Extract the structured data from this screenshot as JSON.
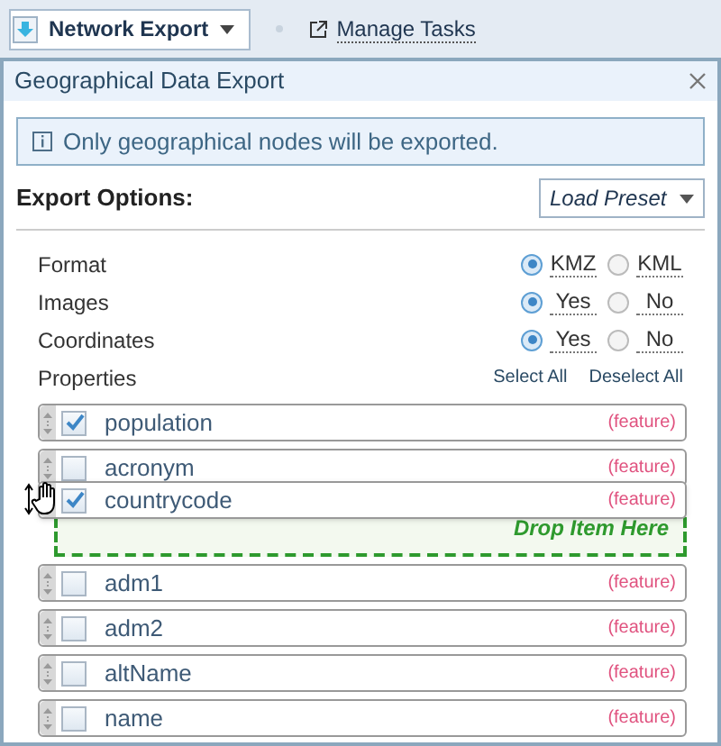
{
  "toolbar": {
    "menu_button": "Network Export",
    "link": "Manage Tasks"
  },
  "dialog": {
    "title": "Geographical Data Export",
    "info": "Only geographical nodes will be exported.",
    "section_title": "Export Options:",
    "preset_button": "Load Preset",
    "options": [
      {
        "label": "Format",
        "choices": [
          {
            "label": "KMZ",
            "selected": true
          },
          {
            "label": "KML",
            "selected": false
          }
        ]
      },
      {
        "label": "Images",
        "choices": [
          {
            "label": "Yes",
            "selected": true
          },
          {
            "label": "No",
            "selected": false
          }
        ]
      },
      {
        "label": "Coordinates",
        "choices": [
          {
            "label": "Yes",
            "selected": true
          },
          {
            "label": "No",
            "selected": false
          }
        ]
      }
    ],
    "properties": {
      "label": "Properties",
      "select_all": "Select All",
      "deselect_all": "Deselect All",
      "items": [
        {
          "kind": "property",
          "label": "population",
          "tag": "(feature)",
          "checked": true
        },
        {
          "kind": "property",
          "label": "acronym",
          "tag": "(feature)",
          "checked": false
        },
        {
          "kind": "drop-zone",
          "label": "Drop Item Here",
          "dragged": {
            "label": "countrycode",
            "tag": "(feature)",
            "checked": true
          }
        },
        {
          "kind": "property",
          "label": "adm1",
          "tag": "(feature)",
          "checked": false
        },
        {
          "kind": "property",
          "label": "adm2",
          "tag": "(feature)",
          "checked": false
        },
        {
          "kind": "property",
          "label": "altName",
          "tag": "(feature)",
          "checked": false
        },
        {
          "kind": "property",
          "label": "name",
          "tag": "(feature)",
          "checked": false
        }
      ]
    }
  }
}
